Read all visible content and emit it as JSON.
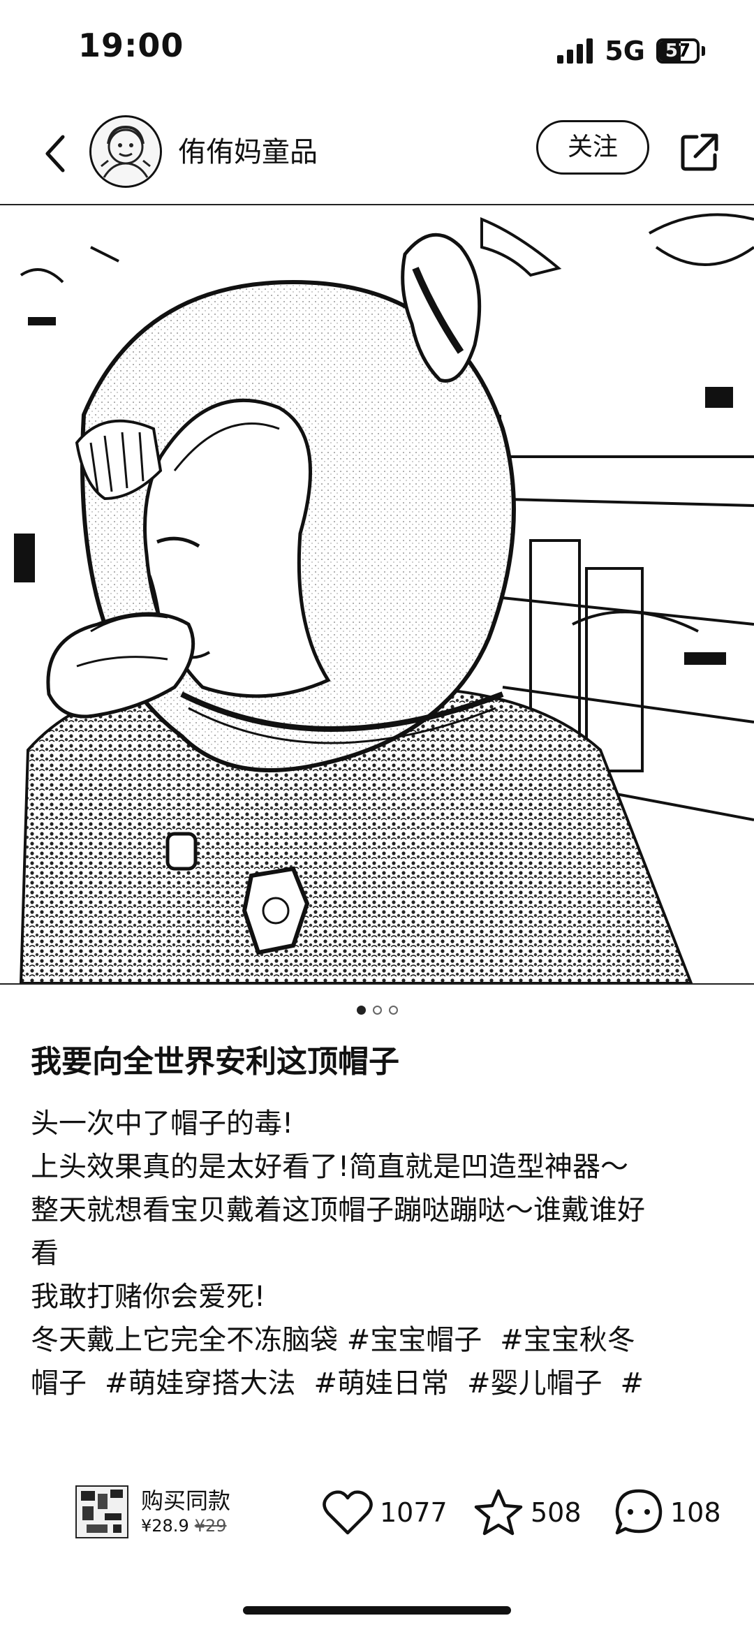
{
  "status_bar": {
    "time": "19:00",
    "network": "5G",
    "battery": "57",
    "battery_level": 0.57
  },
  "header": {
    "author_name": "侑侑妈童品",
    "follow_label": "关注"
  },
  "carousel": {
    "current": 1,
    "total": 3
  },
  "post": {
    "title": "我要向全世界安利这顶帽子",
    "lines": [
      "头一次中了帽子的毒!",
      "上头效果真的是太好看了!简直就是凹造型神器～",
      "整天就想看宝贝戴着这顶帽子蹦哒蹦哒～谁戴谁好",
      "看",
      "我敢打赌你会爱死!",
      "冬天戴上它完全不冻脑袋"
    ],
    "tags": {
      "t1": "#宝宝帽子",
      "t2": "#宝宝秋冬",
      "t2b": "帽子",
      "t3": "#萌娃穿搭大法",
      "t4": "#萌娃日常",
      "t5": "#婴儿帽子",
      "t6": "#"
    }
  },
  "product": {
    "label": "购买同款",
    "price": "¥28.9",
    "original_price": "¥29"
  },
  "actions": {
    "likes": "1077",
    "collects": "508",
    "comments": "108"
  },
  "icons": {
    "back": "chevron-left-icon",
    "share": "share-icon",
    "like": "heart-icon",
    "collect": "star-icon",
    "comment": "comment-bubble-icon"
  }
}
